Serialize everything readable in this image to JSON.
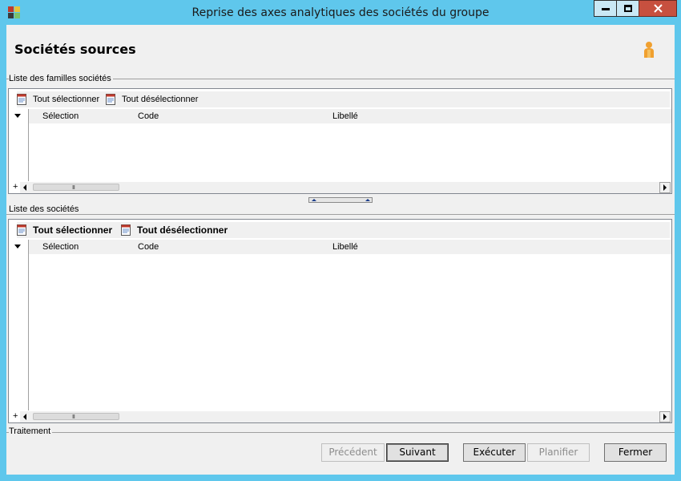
{
  "window": {
    "title": "Reprise des axes analytiques des sociétés du groupe",
    "minimize_glyph": "—",
    "maximize_glyph": "□",
    "close_glyph": "✕",
    "accent_color": "#5fc7ec"
  },
  "header": {
    "title": "Sociétés sources",
    "user_icon": "user-icon"
  },
  "families": {
    "group_label": "Liste des familles sociétés",
    "toolbar": {
      "select_all": "Tout sélectionner",
      "deselect_all": "Tout désélectionner"
    },
    "columns": [
      "Sélection",
      "Code",
      "Libellé"
    ],
    "rows": [],
    "add_glyph": "+"
  },
  "companies": {
    "group_label": "Liste des sociétés",
    "toolbar": {
      "select_all": "Tout sélectionner",
      "deselect_all": "Tout désélectionner"
    },
    "columns": [
      "Sélection",
      "Code",
      "Libellé"
    ],
    "rows": [],
    "add_glyph": "+"
  },
  "treatment": {
    "group_label": "Traitement",
    "buttons": {
      "previous": "Précédent",
      "next": "Suivant",
      "execute": "Exécuter",
      "schedule": "Planifier",
      "close": "Fermer"
    }
  }
}
